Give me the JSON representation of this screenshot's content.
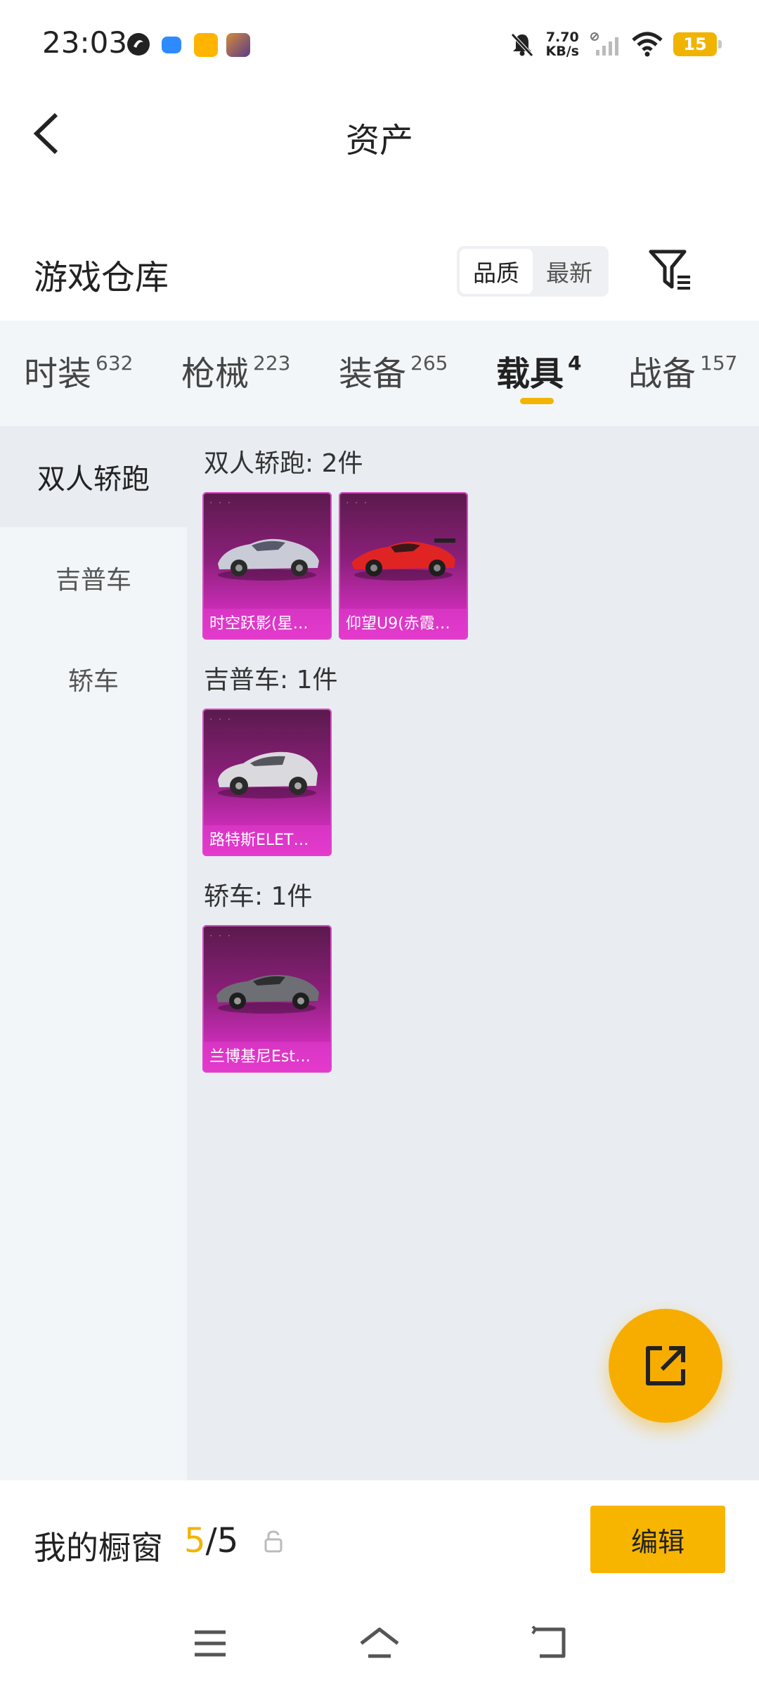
{
  "status_bar": {
    "time": "23:03",
    "net_speed_value": "7.70",
    "net_speed_unit": "KB/s",
    "battery": "15"
  },
  "nav": {
    "title": "资产"
  },
  "warehouse": {
    "title": "游戏仓库",
    "sort_options": [
      "品质",
      "最新"
    ],
    "active_sort": "品质"
  },
  "tabs": [
    {
      "label": "时装",
      "count": "632"
    },
    {
      "label": "枪械",
      "count": "223"
    },
    {
      "label": "装备",
      "count": "265"
    },
    {
      "label": "载具",
      "count": "4",
      "active": true
    },
    {
      "label": "战备",
      "count": "157"
    }
  ],
  "side_nav": {
    "items": [
      "双人轿跑",
      "吉普车",
      "轿车"
    ],
    "active": "双人轿跑"
  },
  "groups": [
    {
      "title": "双人轿跑: 2件",
      "items": [
        {
          "name": "时空跃影(星…",
          "car_color": "#c9ccd6"
        },
        {
          "name": "仰望U9(赤霞…",
          "car_color": "#e02424"
        }
      ]
    },
    {
      "title": "吉普车: 1件",
      "items": [
        {
          "name": "路特斯ELET…",
          "car_color": "#d9d9de"
        }
      ]
    },
    {
      "title": "轿车: 1件",
      "items": [
        {
          "name": "兰博基尼Est…",
          "car_color": "#6d6f74"
        }
      ]
    }
  ],
  "showcase": {
    "label": "我的橱窗",
    "current": "5",
    "separator": "/",
    "total": "5",
    "edit_label": "编辑"
  },
  "colors": {
    "accent": "#f2b400",
    "card_gradient_top": "#5a1a4c",
    "card_gradient_bottom": "#e239c8"
  }
}
